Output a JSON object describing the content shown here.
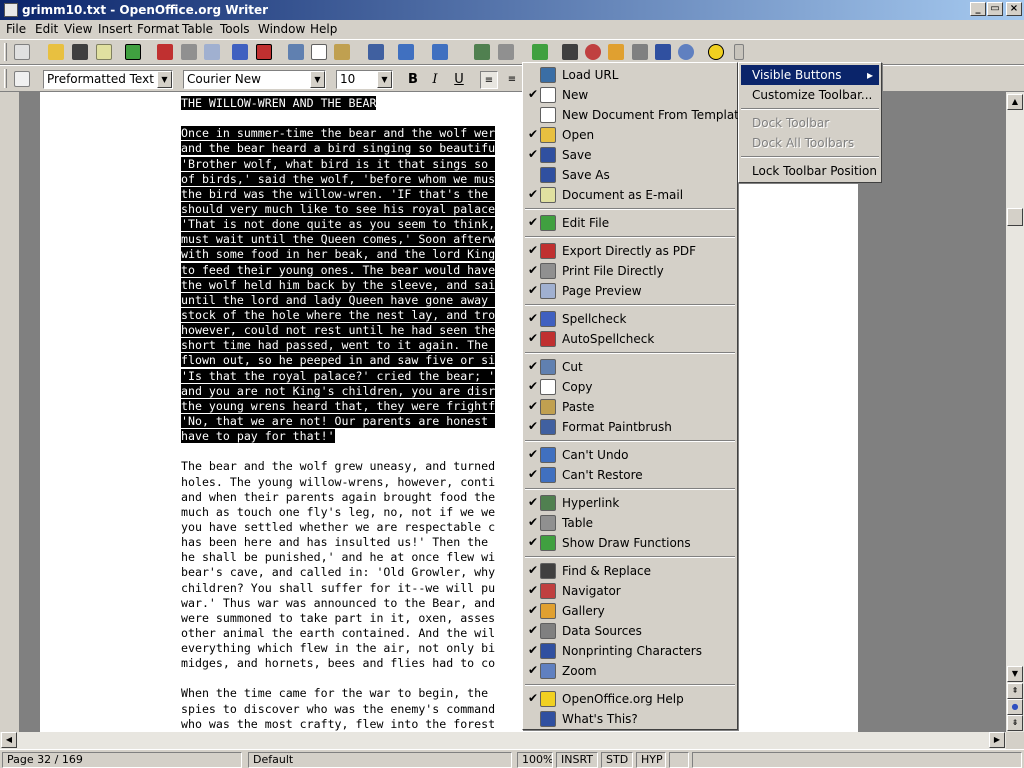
{
  "window": {
    "title": "grimm10.txt - OpenOffice.org Writer"
  },
  "menubar": [
    "File",
    "Edit",
    "View",
    "Insert",
    "Format",
    "Table",
    "Tools",
    "Window",
    "Help"
  ],
  "formatting": {
    "style": "Preformatted Text",
    "font": "Courier New",
    "size": "10",
    "bold": "B",
    "italic": "I",
    "underline": "U"
  },
  "document": {
    "selected_lines": [
      "THE WILLOW-WREN AND THE BEAR",
      "",
      "Once in summer-time the bear and the wolf wer",
      "and the bear heard a bird singing so beautifu",
      "'Brother wolf, what bird is it that sings so ",
      "of birds,' said the wolf, 'before whom we mus",
      "the bird was the willow-wren. 'IF that's the ",
      "should very much like to see his royal palace",
      "'That is not done quite as you seem to think,",
      "must wait until the Queen comes,' Soon afterw",
      "with some food in her beak, and the lord King",
      "to feed their young ones. The bear would have",
      "the wolf held him back by the sleeve, and sai",
      "until the lord and lady Queen have gone away ",
      "stock of the hole where the nest lay, and tro",
      "however, could not rest until he had seen the",
      "short time had passed, went to it again. The ",
      "flown out, so he peeped in and saw five or si",
      "'Is that the royal palace?' cried the bear; '",
      "and you are not King's children, you are disr",
      "the young wrens heard that, they were frightf",
      "'No, that we are not! Our parents are honest ",
      "have to pay for that!'"
    ],
    "lines": [
      "",
      "The bear and the wolf grew uneasy, and turned",
      "holes. The young willow-wrens, however, conti",
      "and when their parents again brought food the",
      "much as touch one fly's leg, no, not if we we",
      "you have settled whether we are respectable c",
      "has been here and has insulted us!' Then the ",
      "he shall be punished,' and he at once flew wi",
      "bear's cave, and called in: 'Old Growler, why",
      "children? You shall suffer for it--we will pu",
      "war.' Thus war was announced to the Bear, and",
      "were summoned to take part in it, oxen, asses",
      "other animal the earth contained. And the wil",
      "everything which flew in the air, not only bi",
      "midges, and hornets, bees and flies had to co",
      "",
      "When the time came for the war to begin, the ",
      "spies to discover who was the enemy's command",
      "who was the most crafty, flew into the forest"
    ]
  },
  "context_menu": {
    "items": [
      {
        "label": "Load URL",
        "checked": false,
        "icon": "load-url-icon",
        "color": "#3a6ea5"
      },
      {
        "label": "New",
        "checked": true,
        "icon": "new-document-icon",
        "color": "#ffffff"
      },
      {
        "label": "New Document From Template",
        "checked": false,
        "icon": "template-icon",
        "color": "#ffffff"
      },
      {
        "label": "Open",
        "checked": true,
        "icon": "folder-open-icon",
        "color": "#e8c040"
      },
      {
        "label": "Save",
        "checked": true,
        "icon": "save-icon",
        "color": "#3050a0"
      },
      {
        "label": "Save As",
        "checked": false,
        "icon": "save-as-icon",
        "color": "#3050a0"
      },
      {
        "label": "Document as E-mail",
        "checked": true,
        "icon": "email-icon",
        "color": "#e0e0a0"
      },
      {
        "sep": true
      },
      {
        "label": "Edit File",
        "checked": true,
        "icon": "edit-file-icon",
        "color": "#40a040"
      },
      {
        "sep": true
      },
      {
        "label": "Export Directly as PDF",
        "checked": true,
        "icon": "pdf-icon",
        "color": "#c03030"
      },
      {
        "label": "Print File Directly",
        "checked": true,
        "icon": "print-icon",
        "color": "#909090"
      },
      {
        "label": "Page Preview",
        "checked": true,
        "icon": "page-preview-icon",
        "color": "#a0b0d0"
      },
      {
        "sep": true
      },
      {
        "label": "Spellcheck",
        "checked": true,
        "icon": "spellcheck-icon",
        "color": "#4060c0"
      },
      {
        "label": "AutoSpellcheck",
        "checked": true,
        "icon": "autospellcheck-icon",
        "color": "#c03030"
      },
      {
        "sep": true
      },
      {
        "label": "Cut",
        "checked": true,
        "icon": "cut-icon",
        "color": "#6080b0"
      },
      {
        "label": "Copy",
        "checked": true,
        "icon": "copy-icon",
        "color": "#ffffff"
      },
      {
        "label": "Paste",
        "checked": true,
        "icon": "paste-icon",
        "color": "#c0a050"
      },
      {
        "label": "Format Paintbrush",
        "checked": true,
        "icon": "paintbrush-icon",
        "color": "#4060a0"
      },
      {
        "sep": true
      },
      {
        "label": "Can't Undo",
        "checked": true,
        "icon": "undo-icon",
        "color": "#4070c0"
      },
      {
        "label": "Can't Restore",
        "checked": true,
        "icon": "redo-icon",
        "color": "#4070c0"
      },
      {
        "sep": true
      },
      {
        "label": "Hyperlink",
        "checked": true,
        "icon": "hyperlink-icon",
        "color": "#508050"
      },
      {
        "label": "Table",
        "checked": true,
        "icon": "table-icon",
        "color": "#909090"
      },
      {
        "label": "Show Draw Functions",
        "checked": true,
        "icon": "draw-functions-icon",
        "color": "#40a040"
      },
      {
        "sep": true
      },
      {
        "label": "Find & Replace",
        "checked": true,
        "icon": "binoculars-icon",
        "color": "#404040"
      },
      {
        "label": "Navigator",
        "checked": true,
        "icon": "navigator-icon",
        "color": "#c04040"
      },
      {
        "label": "Gallery",
        "checked": true,
        "icon": "gallery-icon",
        "color": "#e0a030"
      },
      {
        "label": "Data Sources",
        "checked": true,
        "icon": "data-sources-icon",
        "color": "#808080"
      },
      {
        "label": "Nonprinting Characters",
        "checked": true,
        "icon": "pilcrow-icon",
        "color": "#3050a0"
      },
      {
        "label": "Zoom",
        "checked": true,
        "icon": "zoom-icon",
        "color": "#6080c0"
      },
      {
        "sep": true
      },
      {
        "label": "OpenOffice.org Help",
        "checked": true,
        "icon": "help-icon",
        "color": "#f0d020"
      },
      {
        "label": "What's This?",
        "checked": false,
        "icon": "whats-this-icon",
        "color": "#3050a0"
      }
    ]
  },
  "submenu": {
    "items": [
      {
        "label": "Visible Buttons",
        "state": "active",
        "arrow": "▸"
      },
      {
        "label": "Customize Toolbar...",
        "state": "normal"
      },
      {
        "sep": true
      },
      {
        "label": "Dock Toolbar",
        "state": "disabled"
      },
      {
        "label": "Dock All Toolbars",
        "state": "disabled"
      },
      {
        "sep": true
      },
      {
        "label": "Lock Toolbar Position",
        "state": "normal"
      }
    ]
  },
  "statusbar": {
    "page": "Page 32 / 169",
    "style": "Default",
    "zoom": "100%",
    "insert": "INSRT",
    "selection": "STD",
    "hyperlink": "HYP"
  },
  "colors": {
    "titlebar": "#0a246a",
    "menu_highlight": "#0a246a",
    "selection": "#000000",
    "face": "#d4d0c8"
  }
}
